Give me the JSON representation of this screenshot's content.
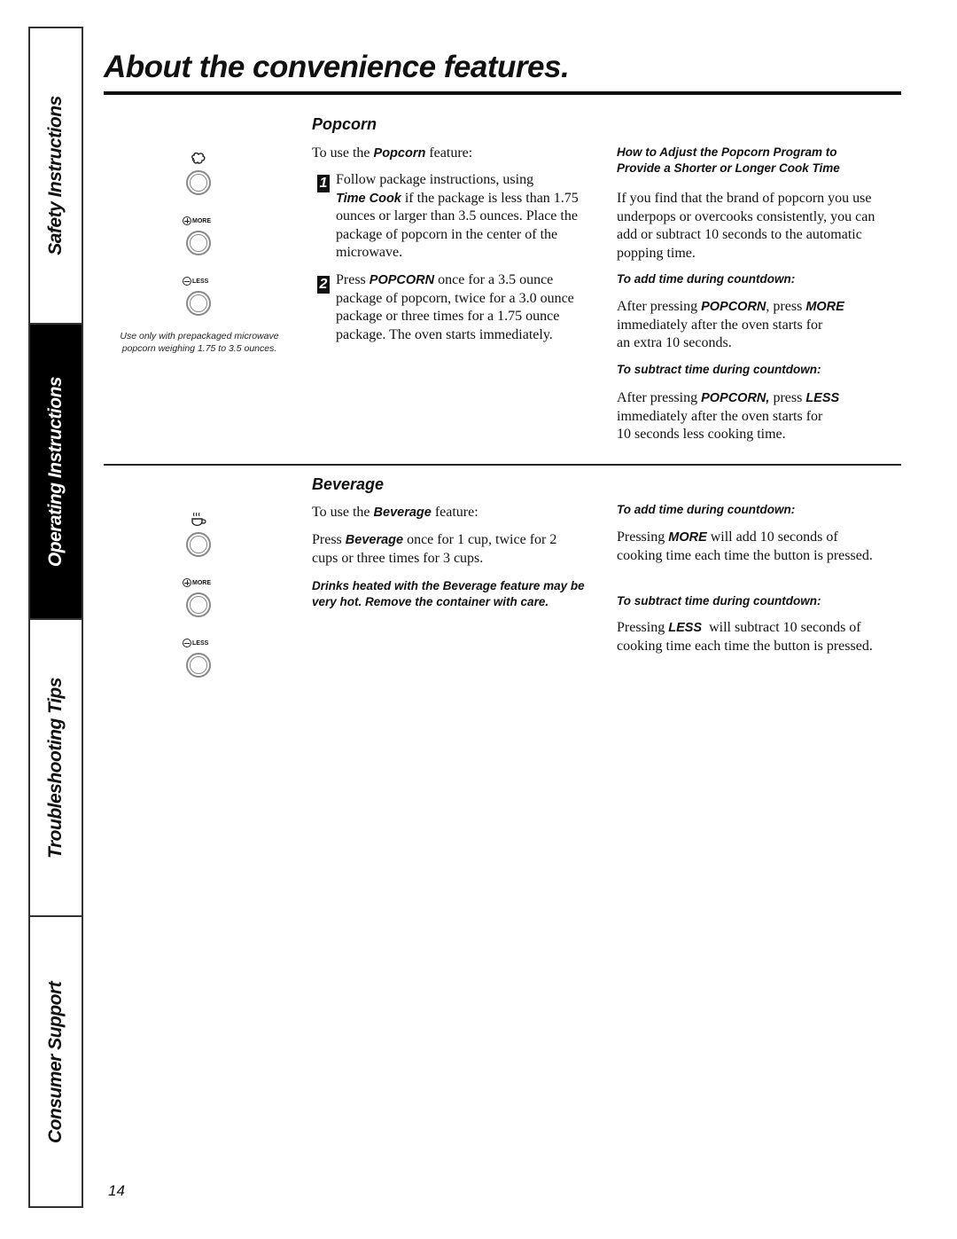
{
  "sidebar": {
    "tabs": [
      {
        "label": "Safety Instructions",
        "active": false
      },
      {
        "label": "Operating Instructions",
        "active": true
      },
      {
        "label": "Troubleshooting Tips",
        "active": false
      },
      {
        "label": "Consumer Support",
        "active": false
      }
    ]
  },
  "page": {
    "title": "About the convenience features.",
    "number": "14"
  },
  "popcorn": {
    "heading": "Popcorn",
    "intro_pre": "To use the",
    "intro_bold": "Popcorn",
    "intro_post": " feature:",
    "step1": {
      "num": "1",
      "line1": "Follow package instructions, using",
      "bold": "Time Cook",
      "rest": " if the package is less than 1.75 ounces or larger than 3.5 ounces. Place the package of popcorn in the center of the microwave."
    },
    "step2": {
      "num": "2",
      "pre": "Press ",
      "bold": "POPCORN",
      "rest": " once for a 3.5 ounce package of popcorn, twice for a 3.0 ounce package or three times for a 1.75 ounce package. The oven starts immediately."
    },
    "buttons": {
      "icon": "popcorn-icon",
      "more_label": "MORE",
      "less_label": "LESS"
    },
    "note": "Use only with prepackaged microwave popcorn weighing 1.75 to 3.5 ounces.",
    "adjust": {
      "heading": "How to Adjust the Popcorn Program to Provide a Shorter or Longer Cook Time",
      "body": "If you find that the brand of popcorn you use underpops or overcooks consistently, you can add or subtract 10 seconds to the automatic popping time.",
      "add_heading": "To add time during countdown:",
      "add_pre": "After pressing ",
      "add_bold1": "POPCORN",
      "add_mid": ", press ",
      "add_bold2": "MORE",
      "add_rest": "immediately after the oven starts for an extra 10 seconds.",
      "sub_heading": "To subtract time during countdown:",
      "sub_pre": "After pressing ",
      "sub_bold1": "POPCORN,",
      "sub_mid": " press ",
      "sub_bold2": "LESS",
      "sub_rest": "immediately after the oven starts for 10 seconds less cooking time."
    }
  },
  "beverage": {
    "heading": "Beverage",
    "intro_pre": "To use the ",
    "intro_bold": "Beverage",
    "intro_post": " feature:",
    "press_pre": "Press ",
    "press_bold": "Beverage",
    "press_rest": " once for 1 cup, twice for 2 cups or three times for 3 cups.",
    "warning": "Drinks heated with the Beverage feature may be very hot. Remove the container with care.",
    "buttons": {
      "icon": "beverage-cup-icon",
      "more_label": "MORE",
      "less_label": "LESS"
    },
    "add_heading": "To add time during countdown:",
    "add_pre": "Pressing ",
    "add_bold": "MORE",
    "add_rest": " will add 10 seconds of cooking time each time the button is pressed.",
    "sub_heading": "To subtract time during countdown:",
    "sub_pre": "Pressing ",
    "sub_bold": "LESS",
    "sub_rest": "  will subtract 10 seconds of cooking time each time the button is pressed."
  }
}
